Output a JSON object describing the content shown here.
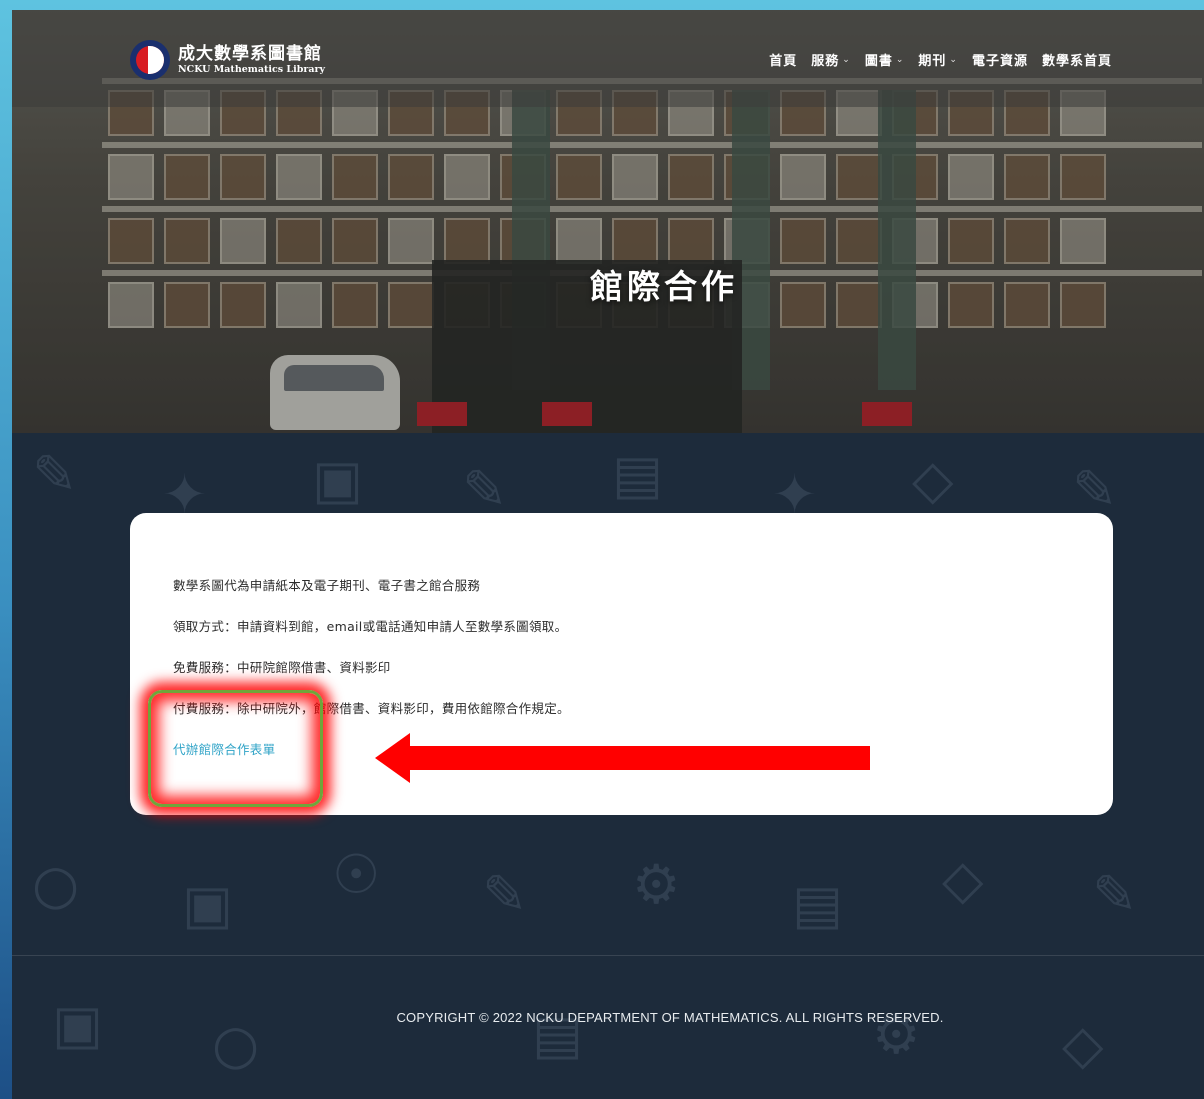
{
  "header": {
    "logo_title": "成大數學系圖書館",
    "logo_subtitle": "NCKU Mathematics Library",
    "nav": [
      {
        "label": "首頁",
        "has_dropdown": false
      },
      {
        "label": "服務",
        "has_dropdown": true
      },
      {
        "label": "圖書",
        "has_dropdown": true
      },
      {
        "label": "期刊",
        "has_dropdown": true
      },
      {
        "label": "電子資源",
        "has_dropdown": false
      },
      {
        "label": "數學系首頁",
        "has_dropdown": false
      }
    ],
    "dropdown_glyph": "⌄"
  },
  "hero": {
    "title": "館際合作"
  },
  "content": {
    "line1": "數學系圖代為申請紙本及電子期刊、電子書之館合服務",
    "line2": "領取方式：申請資料到館，email或電話通知申請人至數學系圖領取。",
    "line3": "免費服務：中研院館際借書、資料影印",
    "line4": "付費服務：除中研院外，館際借書、資料影印，費用依館際合作規定。",
    "form_link": "代辦館際合作表單"
  },
  "annotation": {
    "highlight_color": "#ff0000",
    "arrow_color": "#ff0000"
  },
  "footer": {
    "copyright": "COPYRIGHT © 2022 NCKU DEPARTMENT OF MATHEMATICS. ALL RIGHTS RESERVED."
  },
  "colors": {
    "link": "#2fa3c7",
    "page_bg": "#1d2b3b"
  }
}
